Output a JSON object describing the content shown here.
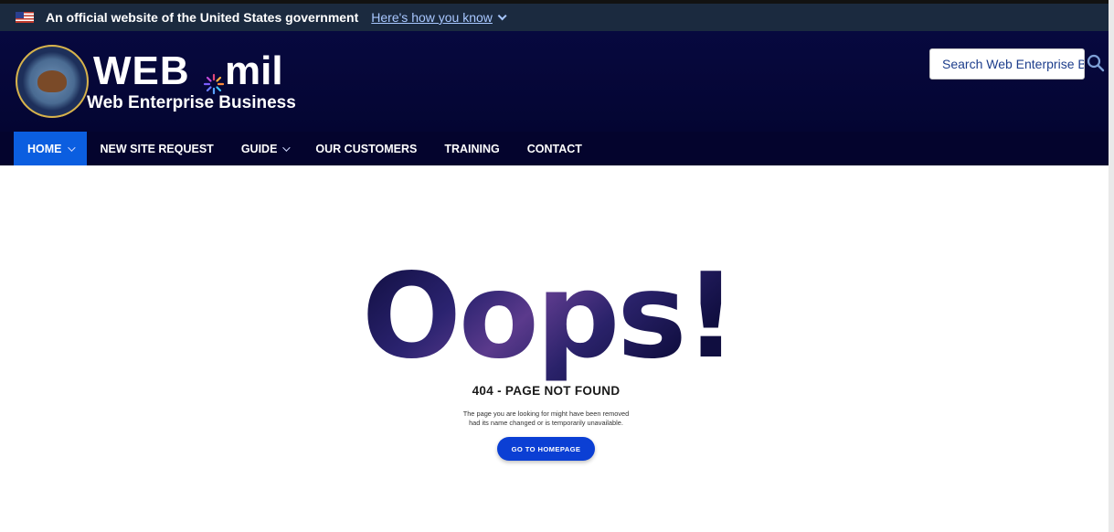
{
  "gov_banner": {
    "text": "An official website of the United States government",
    "link": "Here's how you know"
  },
  "header": {
    "brand_primary": "WEB",
    "brand_secondary": "mil",
    "brand_subtitle": "Web Enterprise Business",
    "search_placeholder": "Search Web Enterprise B"
  },
  "nav": {
    "items": [
      {
        "label": "HOME"
      },
      {
        "label": "NEW SITE REQUEST"
      },
      {
        "label": "GUIDE"
      },
      {
        "label": "OUR CUSTOMERS"
      },
      {
        "label": "TRAINING"
      },
      {
        "label": "CONTACT"
      }
    ]
  },
  "error": {
    "big_text": "Oops!",
    "headline": "404 - PAGE NOT FOUND",
    "message_line1": "The page you are looking for might have been removed",
    "message_line2": "had its name changed or is temporarily unavailable.",
    "button_label": "GO TO HOMEPAGE"
  },
  "colors": {
    "banner_bg": "#1b2a3f",
    "header_bg": "#07093f",
    "nav_active": "#0b5ee0",
    "button_bg": "#0b3fd4",
    "link": "#a8c7ff"
  }
}
